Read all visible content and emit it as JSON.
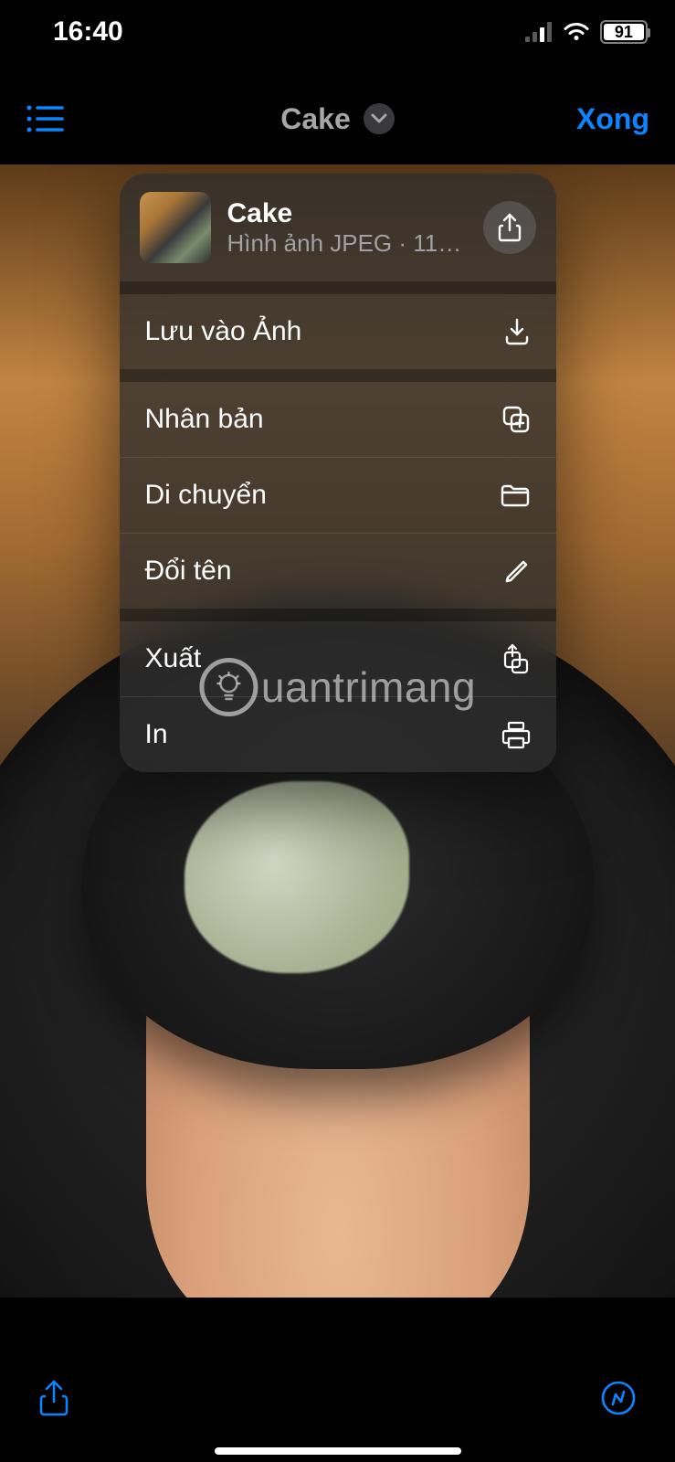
{
  "status": {
    "time": "16:40",
    "battery_pct": "91"
  },
  "nav": {
    "title": "Cake",
    "done": "Xong"
  },
  "popup": {
    "file_name": "Cake",
    "file_meta": "Hình ảnh JPEG · 11…",
    "actions": {
      "save": "Lưu vào Ảnh",
      "duplicate": "Nhân bản",
      "move": "Di chuyển",
      "rename": "Đổi tên",
      "export": "Xuất",
      "print": "In"
    }
  },
  "watermark": "uantrimang"
}
